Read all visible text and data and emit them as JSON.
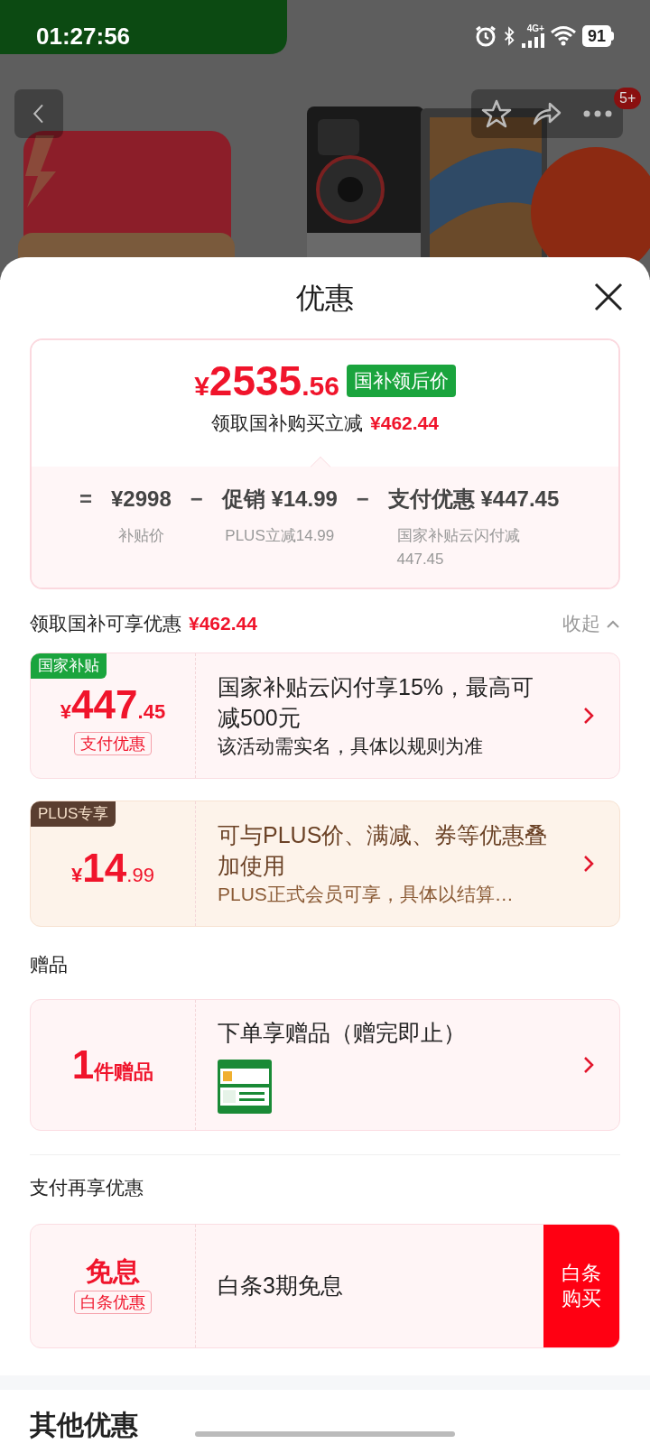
{
  "status_bar": {
    "time": "01:27:56",
    "network": "4G+",
    "battery": "91"
  },
  "nav": {
    "badge": "5+"
  },
  "sheet": {
    "title": "优惠"
  },
  "price_card": {
    "currency": "¥",
    "integer": "2535",
    "decimal": ".56",
    "tag": "国补领后价",
    "saving_label": "领取国补购买立减",
    "saving_amount": "¥462.44",
    "breakdown": [
      {
        "op": "=",
        "value": "¥2998",
        "note": "补贴价"
      },
      {
        "op": "−",
        "value": "促销 ¥14.99",
        "note": "PLUS立减14.99"
      },
      {
        "op": "−",
        "value": "支付优惠 ¥447.45",
        "note": "国家补贴云闪付减447.45"
      }
    ]
  },
  "subsidy_section": {
    "title": "领取国补可享优惠",
    "amount": "¥462.44",
    "toggle": "收起",
    "expanded": true,
    "offers": [
      {
        "kind": "subsidy",
        "tag": "国家补贴",
        "currency": "¥",
        "integer": "447",
        "decimal": ".45",
        "badge": "支付优惠",
        "title": "国家补贴云闪付享15%，最高可减500元",
        "desc": "该活动需实名，具体以规则为准"
      },
      {
        "kind": "plus",
        "tag": "PLUS专享",
        "currency": "¥",
        "integer": "14",
        "decimal": ".99",
        "title": "可与PLUS价、满减、券等优惠叠加使用",
        "desc": "PLUS正式会员可享，具体以结算…"
      }
    ]
  },
  "gift_section": {
    "title": "赠品",
    "count": "1",
    "unit": "件赠品",
    "card_title": "下单享赠品（赠完即止）"
  },
  "pay_section": {
    "title": "支付再享优惠",
    "main": "免息",
    "badge": "白条优惠",
    "card_title": "白条3期免息",
    "button": "白条购买"
  },
  "other_section": {
    "title": "其他优惠"
  }
}
